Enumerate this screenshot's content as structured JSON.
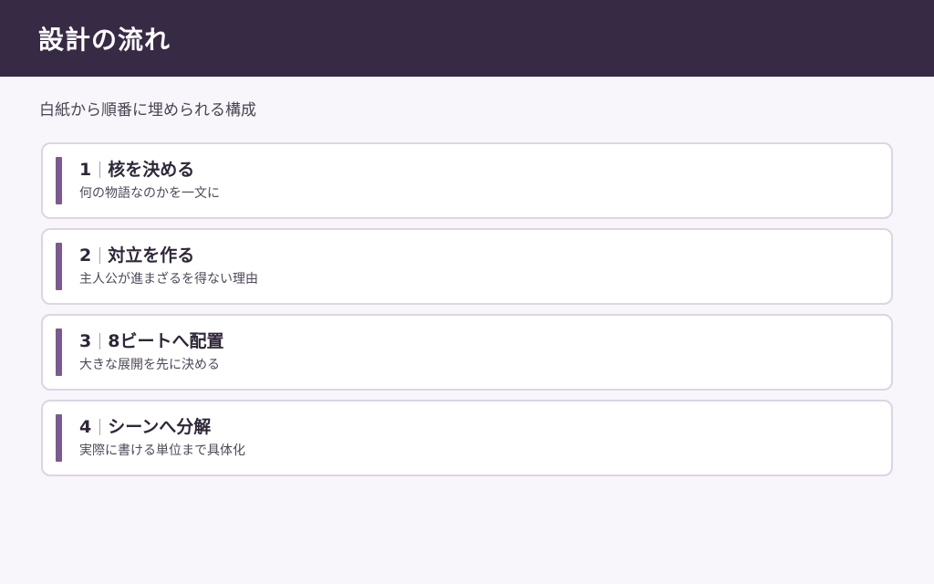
{
  "header": {
    "title": "設計の流れ"
  },
  "subtitle": "白紙から順番に埋められる構成",
  "steps": [
    {
      "number": "1",
      "title": "核を決める",
      "description": "何の物語なのかを一文に"
    },
    {
      "number": "2",
      "title": "対立を作る",
      "description": "主人公が進まざるを得ない理由"
    },
    {
      "number": "3",
      "title": "8ビートへ配置",
      "description": "大きな展開を先に決める"
    },
    {
      "number": "4",
      "title": "シーンへ分解",
      "description": "実際に書ける単位まで具体化"
    }
  ],
  "colors": {
    "header_bg": "#372a45",
    "accent_bar": "#7b5a92",
    "page_bg": "#f8f6fa",
    "card_border": "#dcd5e2"
  }
}
